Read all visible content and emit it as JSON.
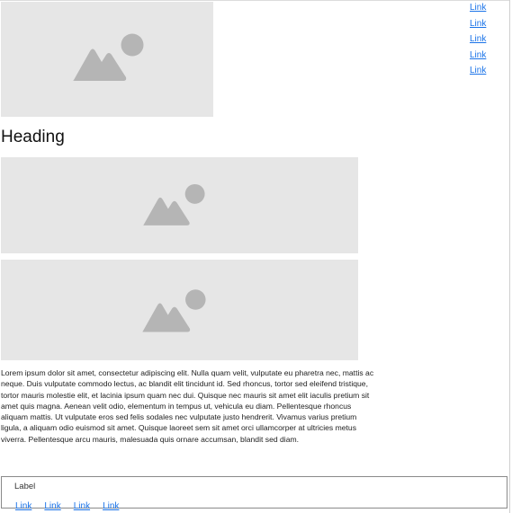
{
  "side_nav": {
    "links": [
      {
        "label": "Link"
      },
      {
        "label": "Link"
      },
      {
        "label": "Link"
      },
      {
        "label": "Link"
      },
      {
        "label": "Link"
      }
    ]
  },
  "main": {
    "heading": "Heading",
    "body_text": "Lorem ipsum dolor sit amet, consectetur adipiscing elit. Nulla quam velit, vulputate eu pharetra nec, mattis ac neque. Duis vulputate commodo lectus, ac blandit elit tincidunt id. Sed rhoncus, tortor sed eleifend tristique, tortor mauris molestie elit, et lacinia ipsum quam nec dui. Quisque nec mauris sit amet elit iaculis pretium sit amet quis magna. Aenean velit odio, elementum in tempus ut, vehicula eu diam. Pellentesque rhoncus aliquam mattis. Ut vulputate eros sed felis sodales nec vulputate justo hendrerit. Vivamus varius pretium ligula, a aliquam odio euismod sit amet. Quisque laoreet sem sit amet orci ullamcorper at ultricies metus viverra. Pellentesque arcu mauris, malesuada quis ornare accumsan, blandit sed diam."
  },
  "footer": {
    "label": "Label",
    "links": [
      {
        "label": "Link"
      },
      {
        "label": "Link"
      },
      {
        "label": "Link"
      },
      {
        "label": "Link"
      }
    ]
  },
  "icons": {
    "image_placeholder": "image-placeholder-icon"
  },
  "colors": {
    "link": "#1a73e8",
    "placeholder_bg": "#e6e6e6",
    "placeholder_icon": "#b5b5b5",
    "footer_border": "#8a8a8a"
  }
}
